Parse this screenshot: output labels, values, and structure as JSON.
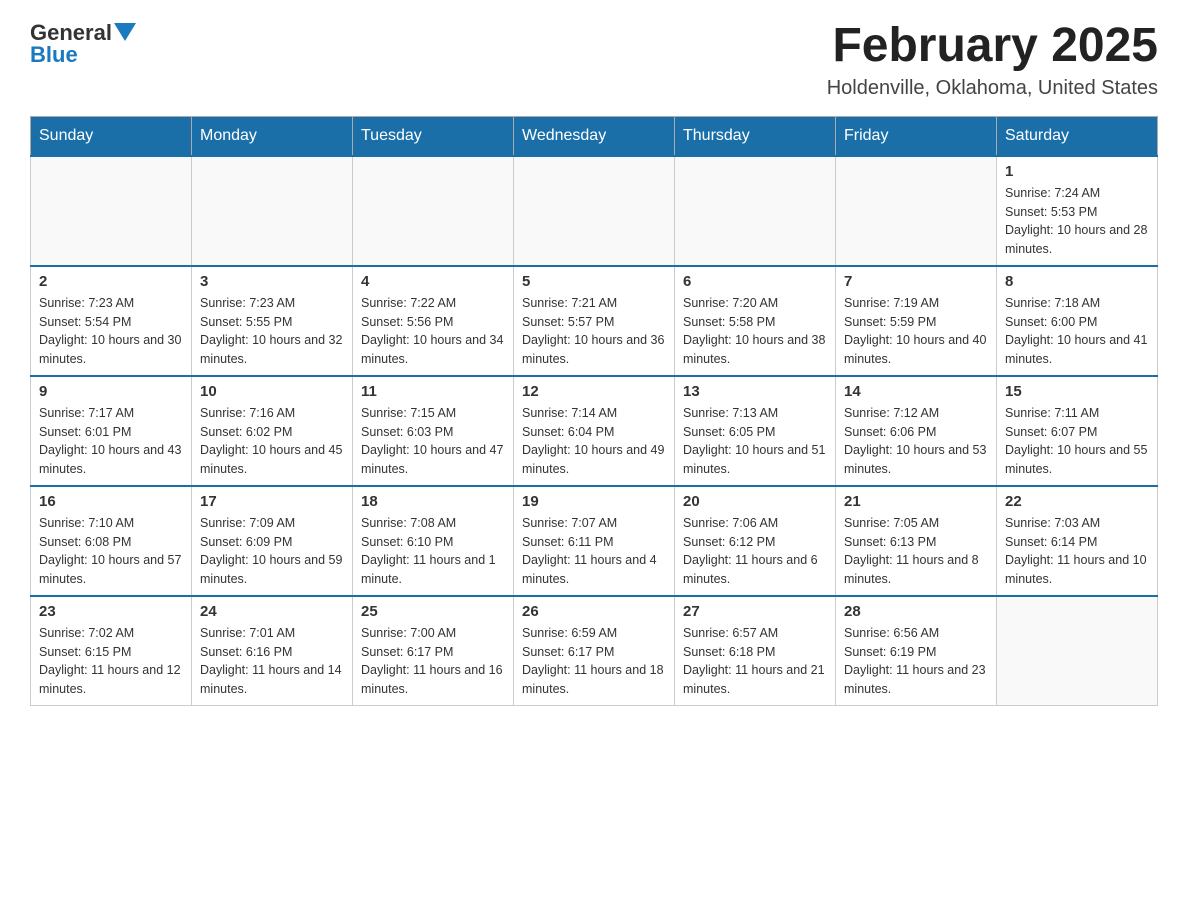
{
  "header": {
    "logo_general": "General",
    "logo_blue": "Blue",
    "title": "February 2025",
    "location": "Holdenville, Oklahoma, United States"
  },
  "days_of_week": [
    "Sunday",
    "Monday",
    "Tuesday",
    "Wednesday",
    "Thursday",
    "Friday",
    "Saturday"
  ],
  "weeks": [
    {
      "days": [
        {
          "num": "",
          "info": ""
        },
        {
          "num": "",
          "info": ""
        },
        {
          "num": "",
          "info": ""
        },
        {
          "num": "",
          "info": ""
        },
        {
          "num": "",
          "info": ""
        },
        {
          "num": "",
          "info": ""
        },
        {
          "num": "1",
          "info": "Sunrise: 7:24 AM\nSunset: 5:53 PM\nDaylight: 10 hours and 28 minutes."
        }
      ]
    },
    {
      "days": [
        {
          "num": "2",
          "info": "Sunrise: 7:23 AM\nSunset: 5:54 PM\nDaylight: 10 hours and 30 minutes."
        },
        {
          "num": "3",
          "info": "Sunrise: 7:23 AM\nSunset: 5:55 PM\nDaylight: 10 hours and 32 minutes."
        },
        {
          "num": "4",
          "info": "Sunrise: 7:22 AM\nSunset: 5:56 PM\nDaylight: 10 hours and 34 minutes."
        },
        {
          "num": "5",
          "info": "Sunrise: 7:21 AM\nSunset: 5:57 PM\nDaylight: 10 hours and 36 minutes."
        },
        {
          "num": "6",
          "info": "Sunrise: 7:20 AM\nSunset: 5:58 PM\nDaylight: 10 hours and 38 minutes."
        },
        {
          "num": "7",
          "info": "Sunrise: 7:19 AM\nSunset: 5:59 PM\nDaylight: 10 hours and 40 minutes."
        },
        {
          "num": "8",
          "info": "Sunrise: 7:18 AM\nSunset: 6:00 PM\nDaylight: 10 hours and 41 minutes."
        }
      ]
    },
    {
      "days": [
        {
          "num": "9",
          "info": "Sunrise: 7:17 AM\nSunset: 6:01 PM\nDaylight: 10 hours and 43 minutes."
        },
        {
          "num": "10",
          "info": "Sunrise: 7:16 AM\nSunset: 6:02 PM\nDaylight: 10 hours and 45 minutes."
        },
        {
          "num": "11",
          "info": "Sunrise: 7:15 AM\nSunset: 6:03 PM\nDaylight: 10 hours and 47 minutes."
        },
        {
          "num": "12",
          "info": "Sunrise: 7:14 AM\nSunset: 6:04 PM\nDaylight: 10 hours and 49 minutes."
        },
        {
          "num": "13",
          "info": "Sunrise: 7:13 AM\nSunset: 6:05 PM\nDaylight: 10 hours and 51 minutes."
        },
        {
          "num": "14",
          "info": "Sunrise: 7:12 AM\nSunset: 6:06 PM\nDaylight: 10 hours and 53 minutes."
        },
        {
          "num": "15",
          "info": "Sunrise: 7:11 AM\nSunset: 6:07 PM\nDaylight: 10 hours and 55 minutes."
        }
      ]
    },
    {
      "days": [
        {
          "num": "16",
          "info": "Sunrise: 7:10 AM\nSunset: 6:08 PM\nDaylight: 10 hours and 57 minutes."
        },
        {
          "num": "17",
          "info": "Sunrise: 7:09 AM\nSunset: 6:09 PM\nDaylight: 10 hours and 59 minutes."
        },
        {
          "num": "18",
          "info": "Sunrise: 7:08 AM\nSunset: 6:10 PM\nDaylight: 11 hours and 1 minute."
        },
        {
          "num": "19",
          "info": "Sunrise: 7:07 AM\nSunset: 6:11 PM\nDaylight: 11 hours and 4 minutes."
        },
        {
          "num": "20",
          "info": "Sunrise: 7:06 AM\nSunset: 6:12 PM\nDaylight: 11 hours and 6 minutes."
        },
        {
          "num": "21",
          "info": "Sunrise: 7:05 AM\nSunset: 6:13 PM\nDaylight: 11 hours and 8 minutes."
        },
        {
          "num": "22",
          "info": "Sunrise: 7:03 AM\nSunset: 6:14 PM\nDaylight: 11 hours and 10 minutes."
        }
      ]
    },
    {
      "days": [
        {
          "num": "23",
          "info": "Sunrise: 7:02 AM\nSunset: 6:15 PM\nDaylight: 11 hours and 12 minutes."
        },
        {
          "num": "24",
          "info": "Sunrise: 7:01 AM\nSunset: 6:16 PM\nDaylight: 11 hours and 14 minutes."
        },
        {
          "num": "25",
          "info": "Sunrise: 7:00 AM\nSunset: 6:17 PM\nDaylight: 11 hours and 16 minutes."
        },
        {
          "num": "26",
          "info": "Sunrise: 6:59 AM\nSunset: 6:17 PM\nDaylight: 11 hours and 18 minutes."
        },
        {
          "num": "27",
          "info": "Sunrise: 6:57 AM\nSunset: 6:18 PM\nDaylight: 11 hours and 21 minutes."
        },
        {
          "num": "28",
          "info": "Sunrise: 6:56 AM\nSunset: 6:19 PM\nDaylight: 11 hours and 23 minutes."
        },
        {
          "num": "",
          "info": ""
        }
      ]
    }
  ]
}
